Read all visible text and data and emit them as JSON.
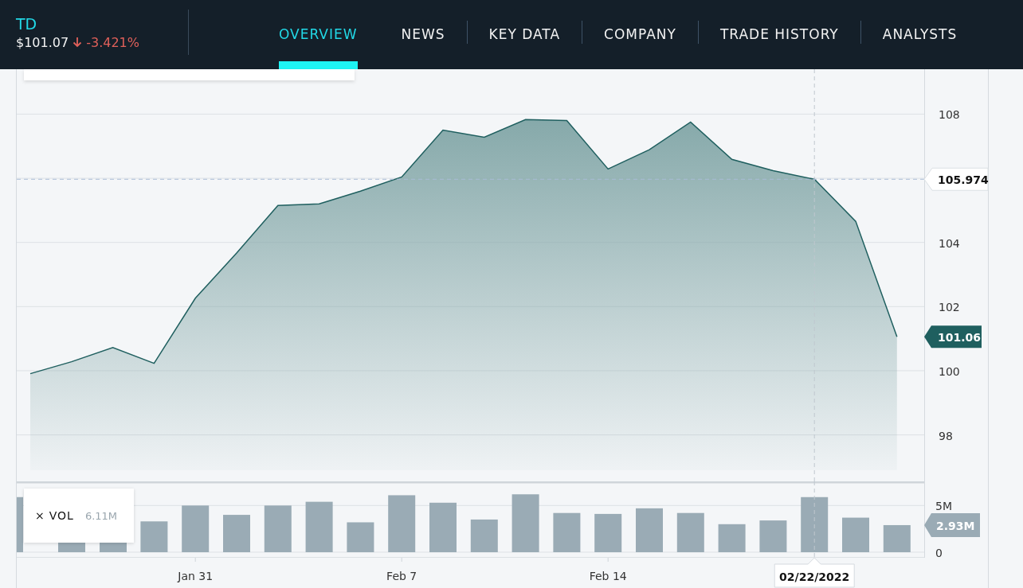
{
  "header": {
    "symbol": "TD",
    "price": "$101.07",
    "change": "-3.421%"
  },
  "tabs": [
    {
      "label": "OVERVIEW",
      "selected": true
    },
    {
      "label": "NEWS",
      "selected": false
    },
    {
      "label": "KEY DATA",
      "selected": false
    },
    {
      "label": "COMPANY",
      "selected": false
    },
    {
      "label": "TRADE HISTORY",
      "selected": false
    },
    {
      "label": "ANALYSTS",
      "selected": false
    }
  ],
  "price_chart": {
    "chart_data": {
      "type": "area",
      "grid": true,
      "series": [
        {
          "color": "#1f5f5f",
          "values": [
            99.91,
            100.28,
            100.72,
            100.23,
            102.26,
            103.67,
            105.15,
            105.2,
            105.6,
            106.04,
            107.5,
            107.28,
            107.83,
            107.8,
            106.29,
            106.89,
            107.75,
            106.59,
            106.24,
            105.97,
            104.66,
            101.06
          ]
        }
      ],
      "ylim": [
        96.6,
        109.4
      ],
      "yticks": [
        98,
        100,
        102,
        104,
        108
      ],
      "ref_lines": [
        {
          "axis": "y",
          "value": 105.97
        }
      ],
      "annotations": [
        "105.974",
        "101.06"
      ]
    }
  },
  "volume_chart": {
    "legend": {
      "close": "×",
      "value": "6.11M"
    },
    "date_labels": [
      "Jan 31",
      "Feb 7",
      "Feb 14"
    ],
    "chart_data": {
      "type": "bar",
      "grid": true,
      "series": [
        {
          "name": "VOL",
          "color": "#9aabb5",
          "values": [
            5.9,
            null,
            null,
            3.3,
            5.0,
            4.0,
            5.0,
            5.4,
            3.2,
            6.1,
            5.3,
            3.5,
            6.2,
            4.2,
            4.1,
            4.7,
            4.2,
            3.0,
            3.4,
            5.9,
            3.7,
            2.9
          ]
        }
      ],
      "ylim": [
        0,
        7.5
      ],
      "yticks": [
        {
          "value": 0,
          "label": "0"
        },
        {
          "value": 5,
          "label": "5M"
        }
      ],
      "annotations": [
        "02/22/2022",
        "2.93M"
      ]
    }
  }
}
